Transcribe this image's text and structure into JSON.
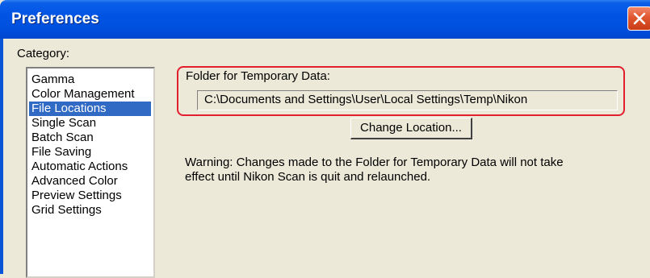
{
  "window": {
    "title": "Preferences",
    "close_icon": "close-icon",
    "colors": {
      "titlebar": "#0054e3",
      "close": "#e0562f",
      "highlight": "#e31e2e",
      "selection": "#316ac5"
    }
  },
  "category": {
    "label": "Category:",
    "selected": "File Locations",
    "items": [
      {
        "label": "Gamma"
      },
      {
        "label": "Color Management"
      },
      {
        "label": "File Locations"
      },
      {
        "label": "Single Scan"
      },
      {
        "label": "Batch Scan"
      },
      {
        "label": "File Saving"
      },
      {
        "label": "Automatic Actions"
      },
      {
        "label": "Advanced Color"
      },
      {
        "label": "Preview Settings"
      },
      {
        "label": "Grid Settings"
      }
    ]
  },
  "folder": {
    "label": "Folder for Temporary Data:",
    "path": "C:\\Documents and Settings\\User\\Local Settings\\Temp\\Nikon",
    "change_button": "Change Location..."
  },
  "warning": {
    "line1": "Warning: Changes made to the Folder for Temporary Data will not take",
    "line2": "effect until Nikon Scan is quit and relaunched."
  }
}
